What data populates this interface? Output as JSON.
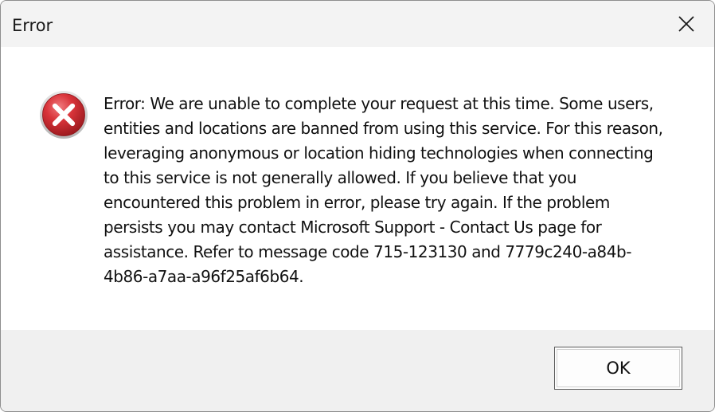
{
  "dialog": {
    "title": "Error",
    "icon": "error-icon",
    "message": "Error: We are unable to complete your request at this time. Some users, entities and locations are banned from using this service. For this reason, leveraging anonymous or location hiding technologies when connecting to this service is not generally allowed. If you believe that you encountered this problem in error, please try again. If the problem persists you may contact Microsoft Support - Contact Us page for assistance. Refer to message code 715-123130 and 7779c240-a84b-4b86-a7aa-a96f25af6b64.",
    "ok_label": "OK",
    "close_icon": "close-icon"
  },
  "colors": {
    "titlebar_bg": "#f3f3f3",
    "content_bg": "#ffffff",
    "footer_bg": "#f0f0f0",
    "error_red": "#c0242a"
  }
}
